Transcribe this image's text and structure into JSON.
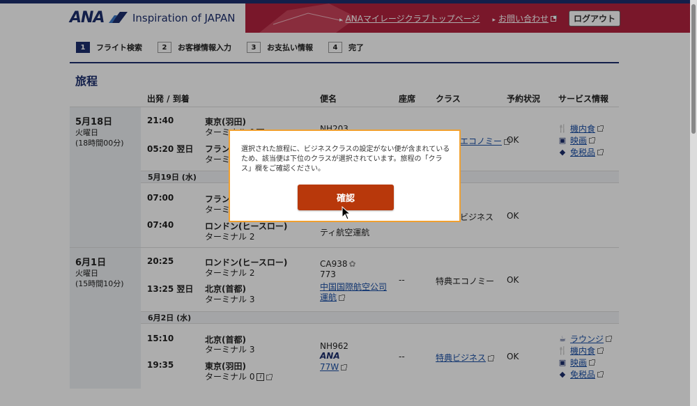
{
  "header": {
    "logo": "ANA",
    "tagline": "Inspiration of JAPAN",
    "links": [
      "ANAマイレージクラブトップページ",
      "お問い合わせ"
    ],
    "logout": "ログアウト"
  },
  "steps": [
    {
      "num": "1",
      "label": "フライト検索"
    },
    {
      "num": "2",
      "label": "お客様情報入力"
    },
    {
      "num": "3",
      "label": "お支払い情報"
    },
    {
      "num": "4",
      "label": "完了"
    }
  ],
  "section_title": "旅程",
  "columns": {
    "dep_arr": "出発 / 到着",
    "flight": "便名",
    "seat": "座席",
    "class": "クラス",
    "status": "予約状況",
    "services": "サービス情報"
  },
  "trip1": {
    "date": "5月18日",
    "weekday": "火曜日",
    "duration": "(18時間00分)",
    "seg1": {
      "dep_time": "21:40",
      "dep_place": "東京(羽田)",
      "dep_term": "ターミナル 0",
      "arr_time": "05:20 翌日",
      "arr_place": "フランクフルト",
      "arr_term": "ターミナル 1",
      "flight": "NH203",
      "class": "エコノミー",
      "status": "OK",
      "services": [
        "機内食",
        "映画",
        "免税品"
      ]
    },
    "subdate": "5月19日 (水)",
    "seg2": {
      "dep_time": "07:00",
      "dep_place": "フランクフルト",
      "dep_term": "ターミナル 1",
      "arr_time": "07:40",
      "arr_place": "ロンドン(ヒースロー)",
      "arr_term": "ターミナル 2",
      "operator": "ティ航空運航",
      "class": "ビジネス",
      "status": "OK"
    }
  },
  "trip2": {
    "date": "6月1日",
    "weekday": "火曜日",
    "duration": "(15時間10分)",
    "seg1": {
      "dep_time": "20:25",
      "dep_place": "ロンドン(ヒースロー)",
      "dep_term": "ターミナル 2",
      "arr_time": "13:25 翌日",
      "arr_place": "北京(首都)",
      "arr_term": "ターミナル 3",
      "flight": "CA938",
      "aircraft": "773",
      "operator_line1": "中国国際航空公司",
      "operator_line2": "運航",
      "seat": "--",
      "class": "特典エコノミー",
      "status": "OK"
    },
    "subdate": "6月2日 (水)",
    "seg2": {
      "dep_time": "15:10",
      "dep_place": "北京(首都)",
      "dep_term": "ターミナル 3",
      "arr_time": "19:35",
      "arr_place": "東京(羽田)",
      "arr_term": "ターミナル 0",
      "flight": "NH962",
      "aircraft": "77W",
      "seat": "--",
      "class": "特典ビジネス",
      "status": "OK",
      "services": [
        "ラウンジ",
        "機内食",
        "映画",
        "免税品"
      ]
    }
  },
  "modal": {
    "message": "選択された旅程に、ビジネスクラスの設定がない便が含まれているため、該当便は下位のクラスが選択されています。旅程の「クラス」欄をご確認ください。",
    "confirm": "確認"
  }
}
